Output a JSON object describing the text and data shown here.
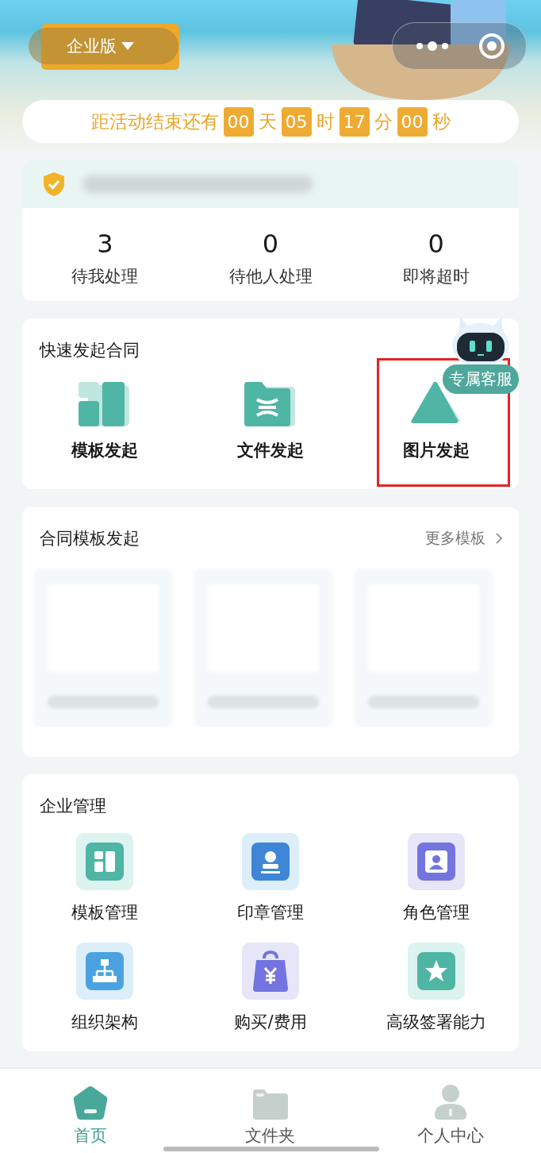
{
  "header": {
    "edition": "企业版",
    "countdown": {
      "prefix": "距活动结束还有",
      "parts": [
        {
          "value": "00",
          "unit": "天"
        },
        {
          "value": "05",
          "unit": "时"
        },
        {
          "value": "17",
          "unit": "分"
        },
        {
          "value": "00",
          "unit": "秒"
        }
      ]
    }
  },
  "tasks": [
    {
      "count": "3",
      "label": "待我处理"
    },
    {
      "count": "0",
      "label": "待他人处理"
    },
    {
      "count": "0",
      "label": "即将超时"
    }
  ],
  "quick_start": {
    "title": "快速发起合同",
    "service_badge": "专属客服",
    "items": [
      {
        "kind": "template",
        "label": "模板发起",
        "highlighted": false
      },
      {
        "kind": "file",
        "label": "文件发起",
        "highlighted": false
      },
      {
        "kind": "image",
        "label": "图片发起",
        "highlighted": true
      }
    ]
  },
  "templates": {
    "title": "合同模板发起",
    "more": "更多模板"
  },
  "management": {
    "title": "企业管理",
    "items": [
      {
        "kind": "template",
        "label": "模板管理"
      },
      {
        "kind": "seal",
        "label": "印章管理"
      },
      {
        "kind": "role",
        "label": "角色管理"
      },
      {
        "kind": "org",
        "label": "组织架构"
      },
      {
        "kind": "purchase",
        "label": "购买/费用"
      },
      {
        "kind": "sign",
        "label": "高级签署能力"
      }
    ]
  },
  "tabs": [
    {
      "kind": "home",
      "label": "首页",
      "selected": true
    },
    {
      "kind": "folder",
      "label": "文件夹",
      "selected": false
    },
    {
      "kind": "person",
      "label": "个人中心",
      "selected": false
    }
  ]
}
